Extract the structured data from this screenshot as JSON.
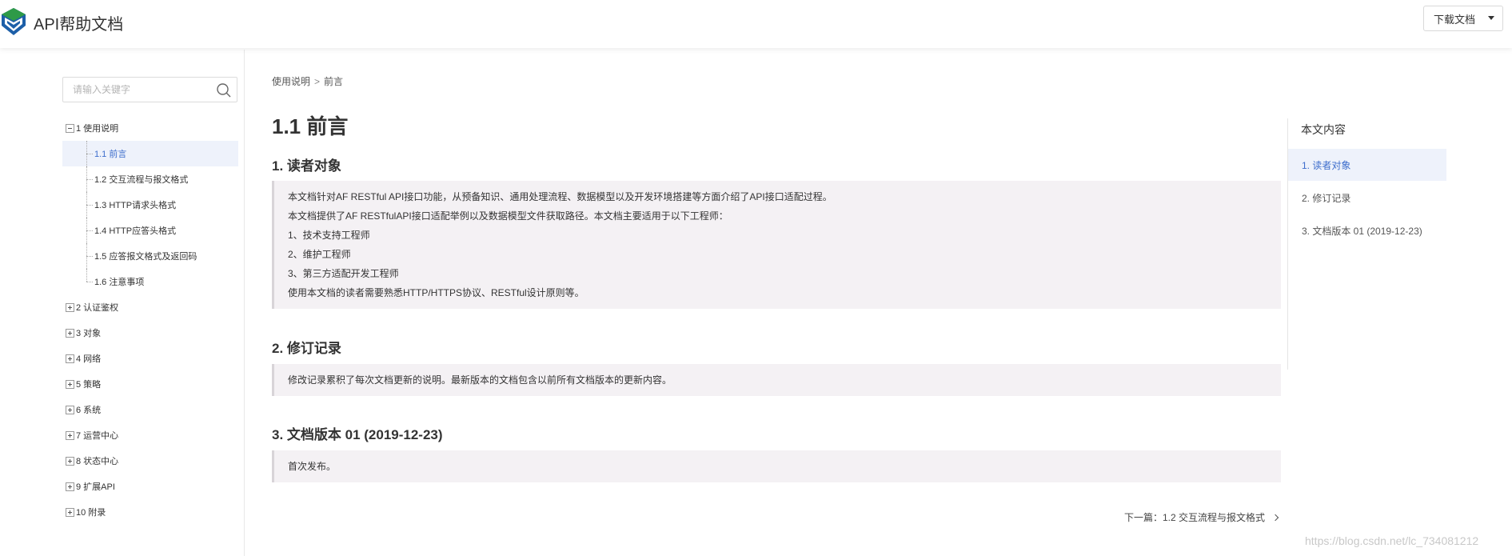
{
  "header": {
    "title": "API帮助文档",
    "download_label": "下载文档"
  },
  "sidebar": {
    "search_placeholder": "请输入关键字",
    "tree": [
      {
        "label": "1 使用说明",
        "expanded": true,
        "children": [
          {
            "label": "1.1 前言",
            "active": true
          },
          {
            "label": "1.2 交互流程与报文格式"
          },
          {
            "label": "1.3 HTTP请求头格式"
          },
          {
            "label": "1.4 HTTP应答头格式"
          },
          {
            "label": "1.5 应答报文格式及返回码"
          },
          {
            "label": "1.6 注意事项"
          }
        ]
      },
      {
        "label": "2 认证鉴权",
        "expanded": false
      },
      {
        "label": "3 对象",
        "expanded": false
      },
      {
        "label": "4 网络",
        "expanded": false
      },
      {
        "label": "5 策略",
        "expanded": false
      },
      {
        "label": "6 系统",
        "expanded": false
      },
      {
        "label": "7 运营中心",
        "expanded": false
      },
      {
        "label": "8 状态中心",
        "expanded": false
      },
      {
        "label": "9 扩展API",
        "expanded": false
      },
      {
        "label": "10 附录",
        "expanded": false
      }
    ]
  },
  "main": {
    "breadcrumb": {
      "parent": "使用说明",
      "separator": ">",
      "current": "前言"
    },
    "title": "1.1 前言",
    "sections": [
      {
        "heading": "1. 读者对象",
        "lines": [
          "本文档针对AF RESTful API接口功能，从预备知识、通用处理流程、数据模型以及开发环境搭建等方面介绍了API接口适配过程。",
          "本文档提供了AF RESTfulAPI接口适配举例以及数据模型文件获取路径。本文档主要适用于以下工程师：",
          "1、技术支持工程师",
          "2、维护工程师",
          "3、第三方适配开发工程师",
          "使用本文档的读者需要熟悉HTTP/HTTPS协议、RESTful设计原则等。"
        ]
      },
      {
        "heading": "2. 修订记录",
        "lines": [
          "修改记录累积了每次文档更新的说明。最新版本的文档包含以前所有文档版本的更新内容。"
        ]
      },
      {
        "heading": "3. 文档版本 01 (2019-12-23)",
        "lines": [
          "首次发布。"
        ]
      }
    ],
    "next_link": "下一篇：1.2 交互流程与报文格式"
  },
  "toc": {
    "title": "本文内容",
    "items": [
      {
        "label": "1. 读者对象",
        "active": true
      },
      {
        "label": "2. 修订记录"
      },
      {
        "label": "3. 文档版本 01 (2019-12-23)"
      }
    ]
  },
  "watermark": "https://blog.csdn.net/lc_734081212",
  "colors": {
    "accent": "#3d6dcc",
    "active_bg": "#eef2fb",
    "block_bg": "#f4f1f4"
  }
}
